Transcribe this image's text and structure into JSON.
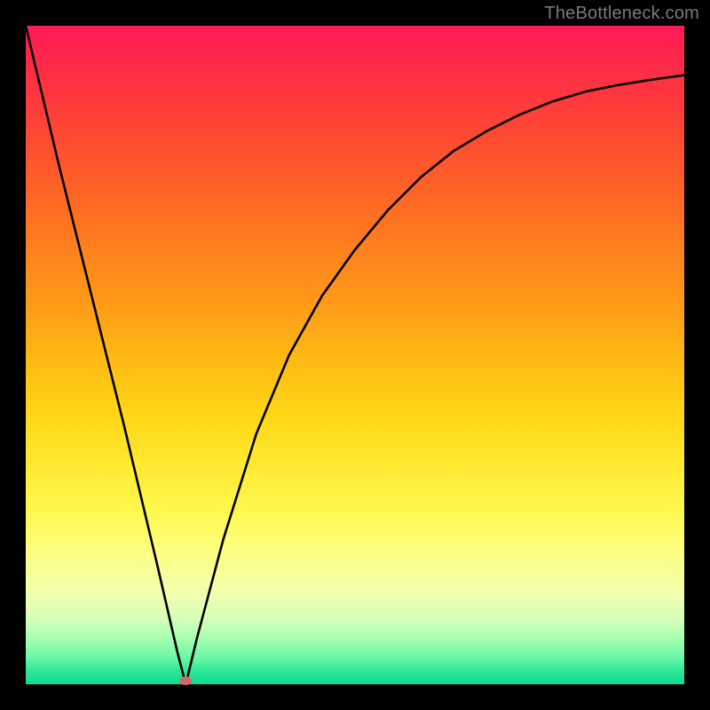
{
  "watermark": "TheBottleneck.com",
  "chart_data": {
    "type": "line",
    "title": "",
    "xlabel": "",
    "ylabel": "",
    "xlim": [
      0,
      100
    ],
    "ylim": [
      0,
      100
    ],
    "grid": false,
    "legend": false,
    "series": [
      {
        "name": "curve",
        "x": [
          0,
          5,
          10,
          15,
          20,
          23,
          24.3,
          26,
          30,
          35,
          40,
          45,
          50,
          55,
          60,
          65,
          70,
          75,
          80,
          85,
          90,
          95,
          100
        ],
        "y": [
          100,
          79,
          59,
          39,
          18,
          5,
          0,
          7,
          22,
          38,
          50,
          59,
          66,
          72,
          77,
          81,
          84,
          86.5,
          88.5,
          90,
          91,
          91.8,
          92.5
        ]
      }
    ],
    "marker": {
      "x": 24.3,
      "y": 0.5,
      "color": "#cd6a6a"
    },
    "gradient": {
      "top": "#ff1a55",
      "bottom": "#0fdc90"
    }
  }
}
